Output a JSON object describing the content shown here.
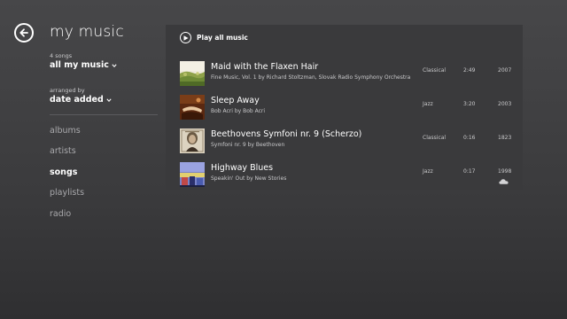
{
  "header": {
    "title": "my music"
  },
  "filters": {
    "count_label": "4 songs",
    "collection": "all my music",
    "arranged_label": "arranged by",
    "arranged_value": "date added"
  },
  "nav": {
    "items": [
      {
        "label": "albums",
        "active": false
      },
      {
        "label": "artists",
        "active": false
      },
      {
        "label": "songs",
        "active": true
      },
      {
        "label": "playlists",
        "active": false
      },
      {
        "label": "radio",
        "active": false
      }
    ]
  },
  "list": {
    "play_all": "Play all music",
    "songs": [
      {
        "title": "Maid with the Flaxen Hair",
        "subtitle": "Fine Music, Vol. 1 by Richard Stoltzman, Slovak Radio Symphony Orchestra",
        "genre": "Classical",
        "duration": "2:49",
        "year": "2007",
        "cover": "cover-flaxen"
      },
      {
        "title": "Sleep Away",
        "subtitle": "Bob Acri by Bob Acri",
        "genre": "Jazz",
        "duration": "3:20",
        "year": "2003",
        "cover": "cover-sleep"
      },
      {
        "title": "Beethovens Symfoni nr. 9 (Scherzo)",
        "subtitle": "Symfoni nr. 9 by Beethoven",
        "genre": "Classical",
        "duration": "0:16",
        "year": "1823",
        "cover": "cover-beethoven"
      },
      {
        "title": "Highway Blues",
        "subtitle": "Speakin' Out by New Stories",
        "genre": "Jazz",
        "duration": "0:17",
        "year": "1998",
        "cover": "cover-highway"
      }
    ]
  },
  "icons": {
    "back": "back-arrow-icon",
    "play": "play-icon",
    "cloud": "cloud-icon",
    "speaker": "speaker-icon",
    "chevron": "chevron-down-icon"
  },
  "colors": {
    "background": "#3f3f41",
    "panel": "#3a3a3c",
    "text_primary": "#ffffff",
    "text_secondary": "#c9c9cb",
    "nav_inactive": "#a9a9ac"
  }
}
